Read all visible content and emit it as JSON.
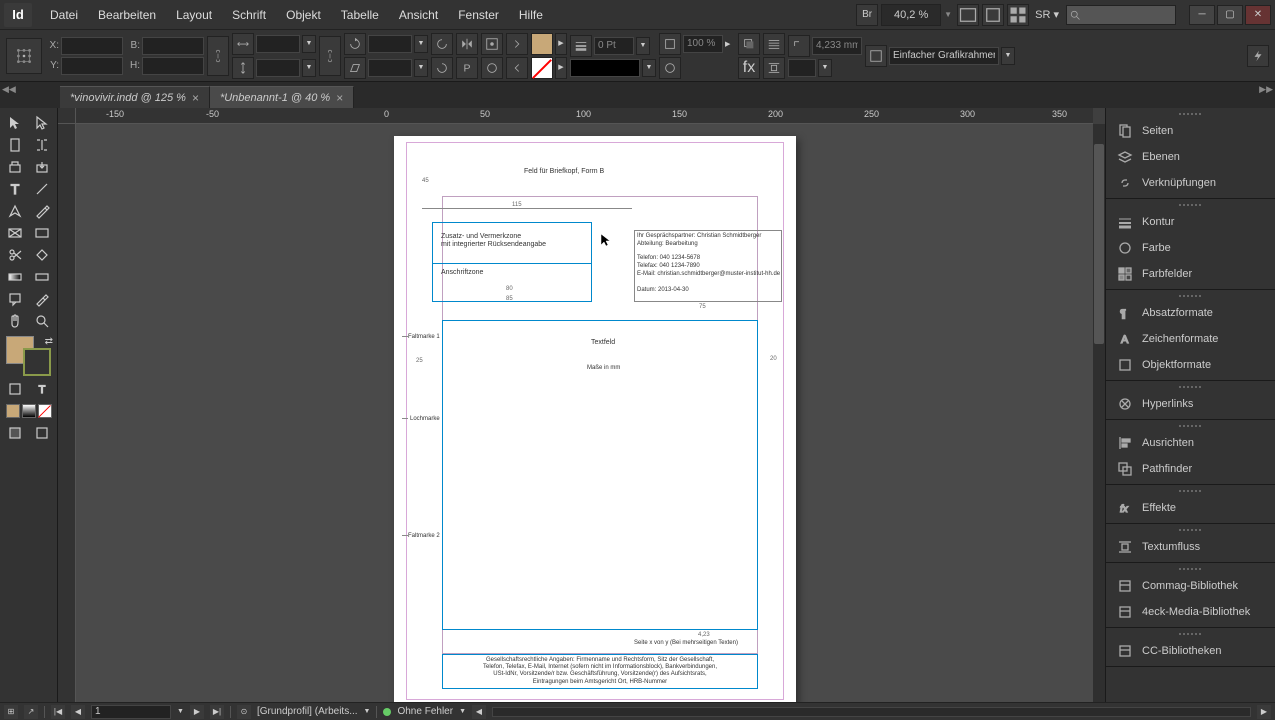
{
  "app": {
    "logo": "Id"
  },
  "menu": {
    "items": [
      "Datei",
      "Bearbeiten",
      "Layout",
      "Schrift",
      "Objekt",
      "Tabelle",
      "Ansicht",
      "Fenster",
      "Hilfe"
    ],
    "bridge": "Br",
    "zoom": "40,2 %",
    "workspace_label": "SR"
  },
  "control": {
    "x_label": "X:",
    "y_label": "Y:",
    "w_label": "B:",
    "h_label": "H:",
    "stroke_value": "0 Pt",
    "opacity_value": "100 %",
    "frame_fitting_label": "Einfacher Grafikrahmen",
    "measure_value": "4,233 mm"
  },
  "tabs": [
    {
      "label": "*vinovivir.indd @ 125 %",
      "active": false
    },
    {
      "label": "*Unbenannt-1 @ 40 %",
      "active": true
    }
  ],
  "ruler_h": [
    "-150",
    "-50",
    "0",
    "50",
    "100",
    "150",
    "200",
    "250",
    "300",
    "350"
  ],
  "document": {
    "header": "Feld für Briefkopf, Form B",
    "zone1_line1": "Zusatz- und Vermerkzone",
    "zone1_line2": "mit integrierter Rücksendeangabe",
    "zone2": "Anschriftzone",
    "dim_115": "115",
    "dim_80": "80",
    "dim_85": "85",
    "dim_45": "45",
    "dim_25": "25",
    "dim_75": "75",
    "dim_20": "20",
    "dim_423": "4,23",
    "faltmarke1": "Faltmarke 1",
    "faltmarke2": "Faltmarke 2",
    "lochmarke": "Lochmarke",
    "contact_line1": "Ihr Gesprächspartner: Christian Schmidtberger",
    "contact_line2": "Abteilung: Bearbeitung",
    "contact_line3": "Telefon: 040 1234-5678",
    "contact_line4": "Telefax: 040 1234-7890",
    "contact_line5": "E-Mail: christian.schmidtberger@muster-institut-hh.de",
    "contact_line6": "Datum: 2013-04-30",
    "textfeld": "Textfeld",
    "masse": "Maße in mm",
    "page_info": "Seite x von y (Bei mehrseitigen Texten)",
    "footer1": "Gesellschaftsrechtliche Angaben: Firmenname und Rechtsform, Sitz der Gesellschaft,",
    "footer2": "Telefon, Telefax, E-Mail, Internet (sofern nicht im Informationsblock), Bankverbindungen,",
    "footer3": "USt-IdNr, Vorsitzende/r bzw. Geschäftsführung, Vorsitzende(r) des Aufsichtsrats,",
    "footer4": "Eintragungen beim Amtsgericht Ort, HRB-Nummer"
  },
  "panels": {
    "seiten": "Seiten",
    "ebenen": "Ebenen",
    "verknuepfungen": "Verknüpfungen",
    "kontur": "Kontur",
    "farbe": "Farbe",
    "farbfelder": "Farbfelder",
    "absatzformate": "Absatzformate",
    "zeichenformate": "Zeichenformate",
    "objektformate": "Objektformate",
    "hyperlinks": "Hyperlinks",
    "ausrichten": "Ausrichten",
    "pathfinder": "Pathfinder",
    "effekte": "Effekte",
    "textumfluss": "Textumfluss",
    "commag": "Commag-Bibliothek",
    "4eck": "4eck-Media-Bibliothek",
    "cc": "CC-Bibliotheken"
  },
  "status": {
    "page": "1",
    "profile": "[Grundprofil] (Arbeits...",
    "errors": "Ohne Fehler"
  }
}
